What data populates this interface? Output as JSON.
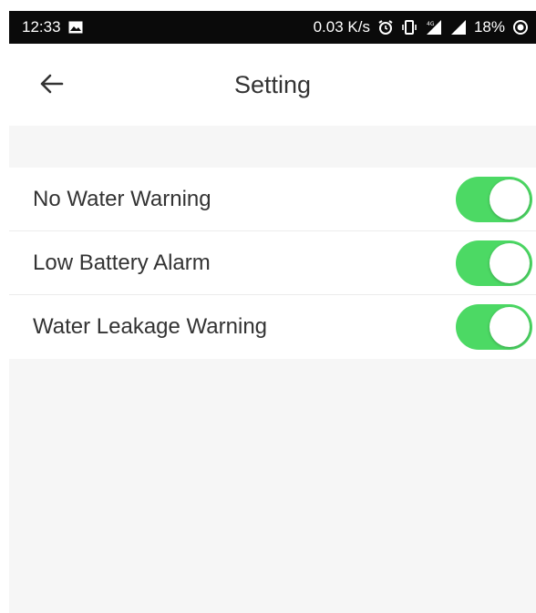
{
  "status_bar": {
    "time": "12:33",
    "speed": "0.03 K/s",
    "battery": "18%",
    "icons": [
      "image-icon",
      "alarm-icon",
      "vibrate-icon",
      "signal-4g-icon",
      "signal-icon",
      "battery-icon"
    ]
  },
  "header": {
    "title": "Setting",
    "back_icon": "arrow-left-icon"
  },
  "settings": [
    {
      "label": "No Water Warning",
      "enabled": true
    },
    {
      "label": "Low Battery Alarm",
      "enabled": true
    },
    {
      "label": "Water Leakage Warning",
      "enabled": true
    }
  ],
  "colors": {
    "toggle_on": "#4cd964",
    "background": "#f6f6f6",
    "status_bar": "#0a0a0a"
  }
}
